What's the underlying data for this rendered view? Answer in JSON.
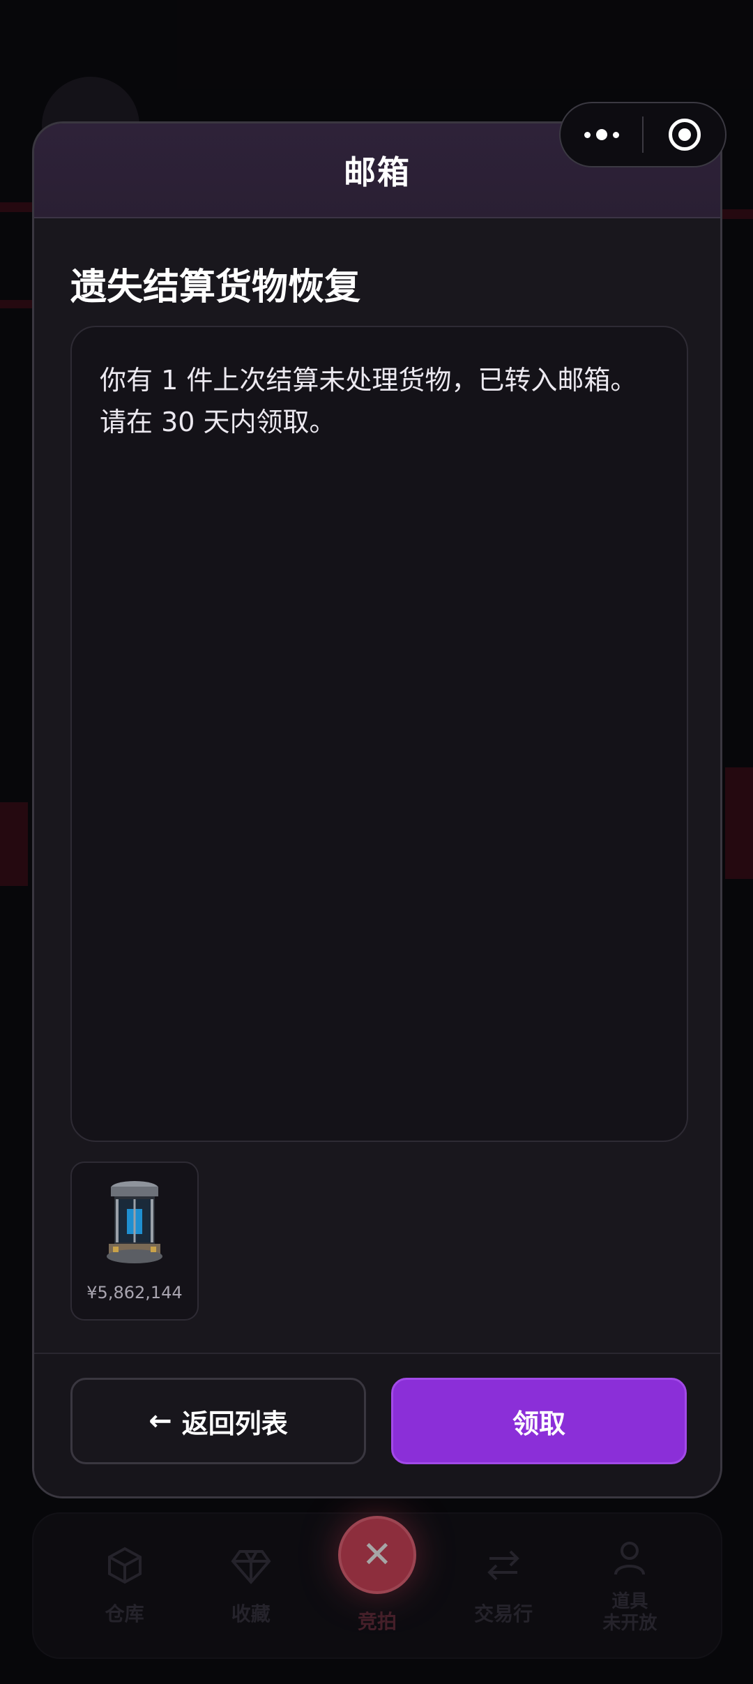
{
  "modal": {
    "title": "邮箱",
    "mail_title": "遗失结算货物恢复",
    "mail_body": "你有 1 件上次结算未处理货物，已转入邮箱。请在 30 天内领取。",
    "attachment": {
      "icon": "canister-item-icon",
      "price": "¥5,862,144"
    },
    "back_button": {
      "arrow": "←",
      "label": "返回列表"
    },
    "claim_button": {
      "label": "领取"
    }
  },
  "capsule": {
    "more_icon": "more-dots-icon",
    "close_icon": "target-close-icon"
  },
  "bottom_nav": {
    "items": [
      {
        "label": "仓库",
        "icon": "box-icon"
      },
      {
        "label": "收藏",
        "icon": "diamond-icon"
      },
      {
        "label": "竞拍",
        "icon": "close-x-icon",
        "glyph": "✕"
      },
      {
        "label": "交易行",
        "icon": "swap-icon"
      },
      {
        "label": "道具",
        "sublabel": "未开放",
        "icon": "person-icon"
      }
    ]
  },
  "colors": {
    "accent_purple": "#8b2fd8",
    "fab_red": "#d9485f",
    "background": "#0c0b10",
    "modal_bg": "#19171d"
  }
}
